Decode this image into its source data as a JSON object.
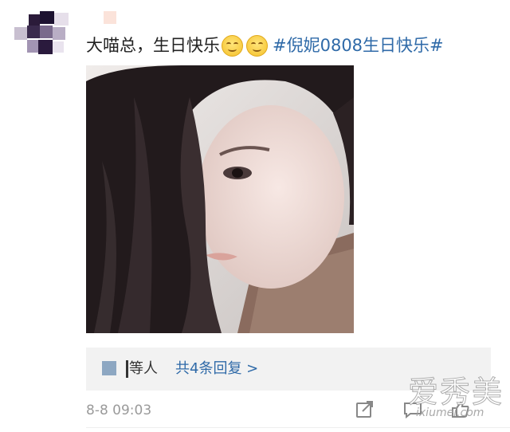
{
  "post": {
    "text": "大喵总，生日快乐",
    "emojis": [
      "smile-emoji",
      "smile-emoji"
    ],
    "hashtag": "#倪妮0808生日快乐#"
  },
  "reply": {
    "people": "等人",
    "link": "共4条回复 >"
  },
  "meta": {
    "time": "8-8 09:03"
  },
  "watermark": {
    "cn": "爱秀美",
    "en": "ixiumei.com"
  },
  "colors": {
    "link": "#2f6aa8",
    "text": "#222222",
    "muted": "#9a9a9a",
    "reply_bg": "#f2f2f2"
  },
  "icons": [
    "share-icon",
    "comment-icon",
    "like-icon"
  ]
}
